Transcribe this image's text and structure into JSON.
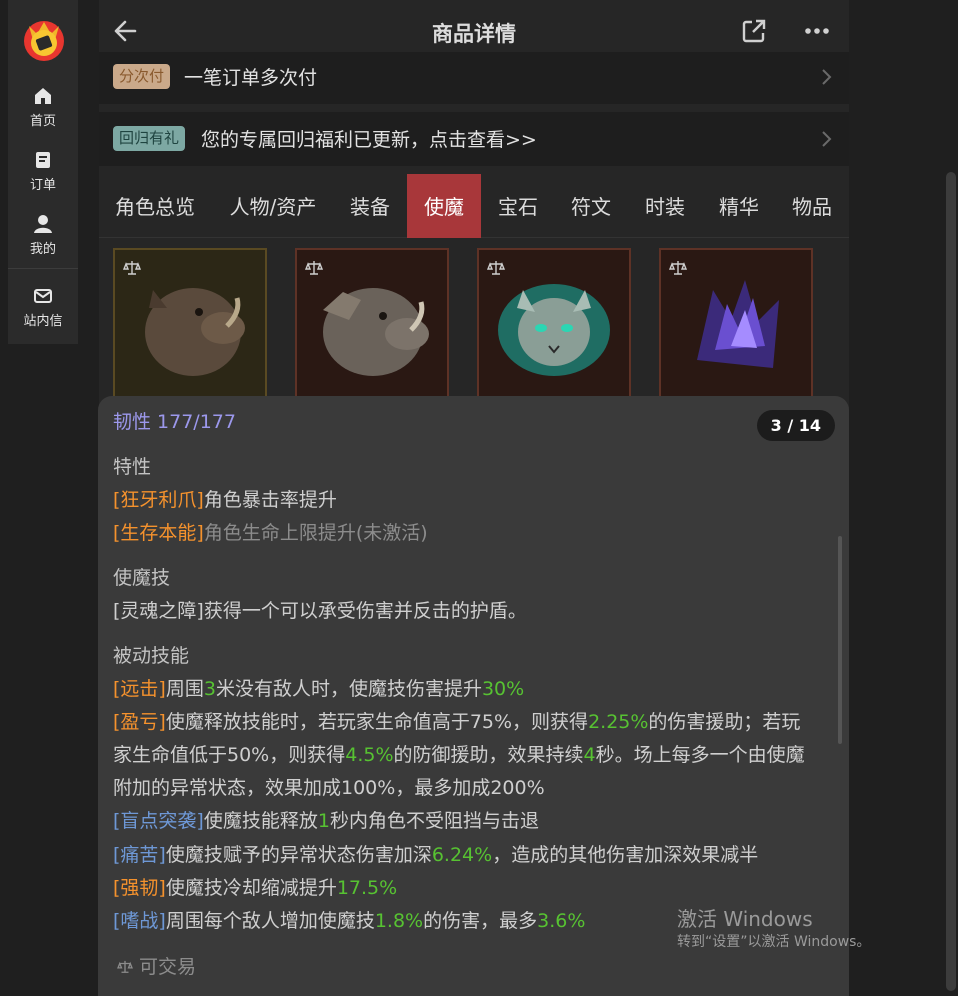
{
  "sidebar": {
    "items": [
      {
        "label": "首页",
        "icon": "home-icon"
      },
      {
        "label": "订单",
        "icon": "order-icon"
      },
      {
        "label": "我的",
        "icon": "user-icon"
      },
      {
        "label": "站内信",
        "icon": "mail-icon"
      }
    ]
  },
  "header": {
    "title": "商品详情",
    "back_icon": "back-arrow-icon",
    "share_icon": "share-icon",
    "more_icon": "more-icon"
  },
  "installment": {
    "tag": "分次付",
    "text": "一笔订单多次付"
  },
  "welfare": {
    "tag": "回归有礼",
    "text": "您的专属回归福利已更新，点击查看>>"
  },
  "tabs": [
    {
      "label": "角色总览"
    },
    {
      "label": "人物/资产"
    },
    {
      "label": "装备"
    },
    {
      "label": "使魔",
      "active": true
    },
    {
      "label": "宝石"
    },
    {
      "label": "符文"
    },
    {
      "label": "时装"
    },
    {
      "label": "精华"
    },
    {
      "label": "物品"
    }
  ],
  "pets": [
    "boar",
    "armored-boar",
    "spirit-cat",
    "void-beast"
  ],
  "detail": {
    "toughness": "韧性 177/177",
    "counter": "3 / 14",
    "traits_title": "特性",
    "trait1_name": "[狂牙利爪]",
    "trait1_desc": "角色暴击率提升",
    "trait2_name": "[生存本能]",
    "trait2_desc": "角色生命上限提升(未激活)",
    "skill_title": "使魔技",
    "skill_text": "[灵魂之障]获得一个可以承受伤害并反击的护盾。",
    "passive_title": "被动技能",
    "p1": {
      "name": "[远击]",
      "a": "周围",
      "v1": "3",
      "b": "米没有敌人时，使魔技伤害提升",
      "v2": "30%"
    },
    "p2": {
      "name": "[盈亏]",
      "a": "使魔释放技能时，若玩家生命值高于75%，则获得",
      "v1": "2.25%",
      "b": "的伤害援助；若玩",
      "c": "家生命值低于50%，则获得",
      "v2": "4.5%",
      "d": "的防御援助，效果持续",
      "v3": "4",
      "e": "秒。场上每多一个由使魔",
      "f": "附加的异常状态，效果加成100%，最多加成200%"
    },
    "p3": {
      "name": "[盲点突袭]",
      "a": "使魔技能释放",
      "v1": "1",
      "b": "秒内角色不受阻挡与击退"
    },
    "p4": {
      "name": "[痛苦]",
      "a": "使魔技赋予的异常状态伤害加深",
      "v1": "6.24%",
      "b": "，造成的其他伤害加深效果减半"
    },
    "p5": {
      "name": "[强韧]",
      "a": "使魔技冷却缩减提升",
      "v1": "17.5%"
    },
    "p6": {
      "name": "[嗜战]",
      "a": "周围每个敌人增加使魔技",
      "v1": "1.8%",
      "b": "的伤害，最多",
      "v2": "3.6%"
    },
    "tradable": "可交易"
  },
  "watermark": {
    "line1": "激活 Windows",
    "line2": "转到“设置”以激活 Windows。"
  },
  "colors": {
    "accent": "#a8373a",
    "orange": "#f5922d",
    "blue": "#6e98d6",
    "green": "#57c232",
    "purple": "#9c98ec"
  }
}
